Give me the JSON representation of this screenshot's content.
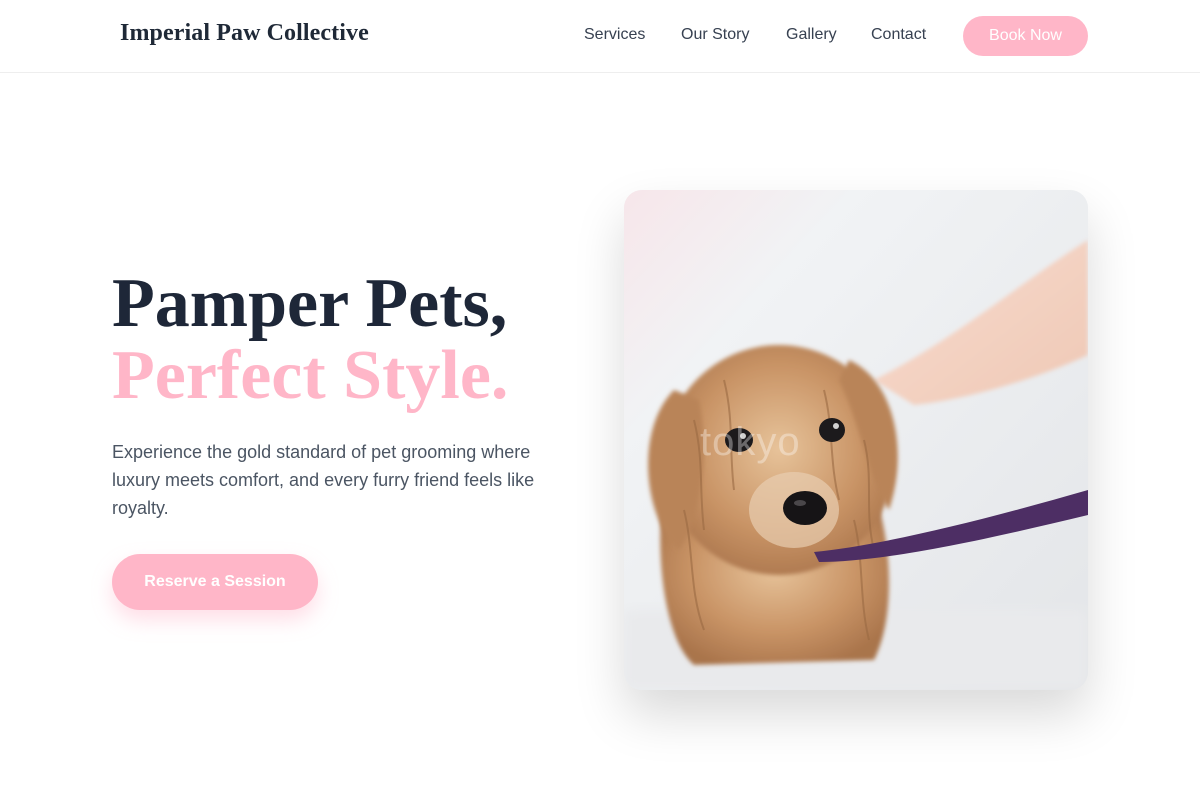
{
  "header": {
    "brand": "Imperial Paw Collective",
    "nav": [
      "Services",
      "Our Story",
      "Gallery",
      "Contact"
    ],
    "cta": "Book Now"
  },
  "hero": {
    "title_line1": "Pamper Pets,",
    "title_line2": "Perfect Style.",
    "description": "Experience the gold standard of pet grooming where luxury meets comfort, and every furry friend feels like royalty.",
    "cta": "Reserve a Session",
    "image_watermark": "tokyo"
  },
  "colors": {
    "accent_pink": "#ffb6c8",
    "heading_dark": "#1e2738",
    "body_text": "#4b5563"
  }
}
